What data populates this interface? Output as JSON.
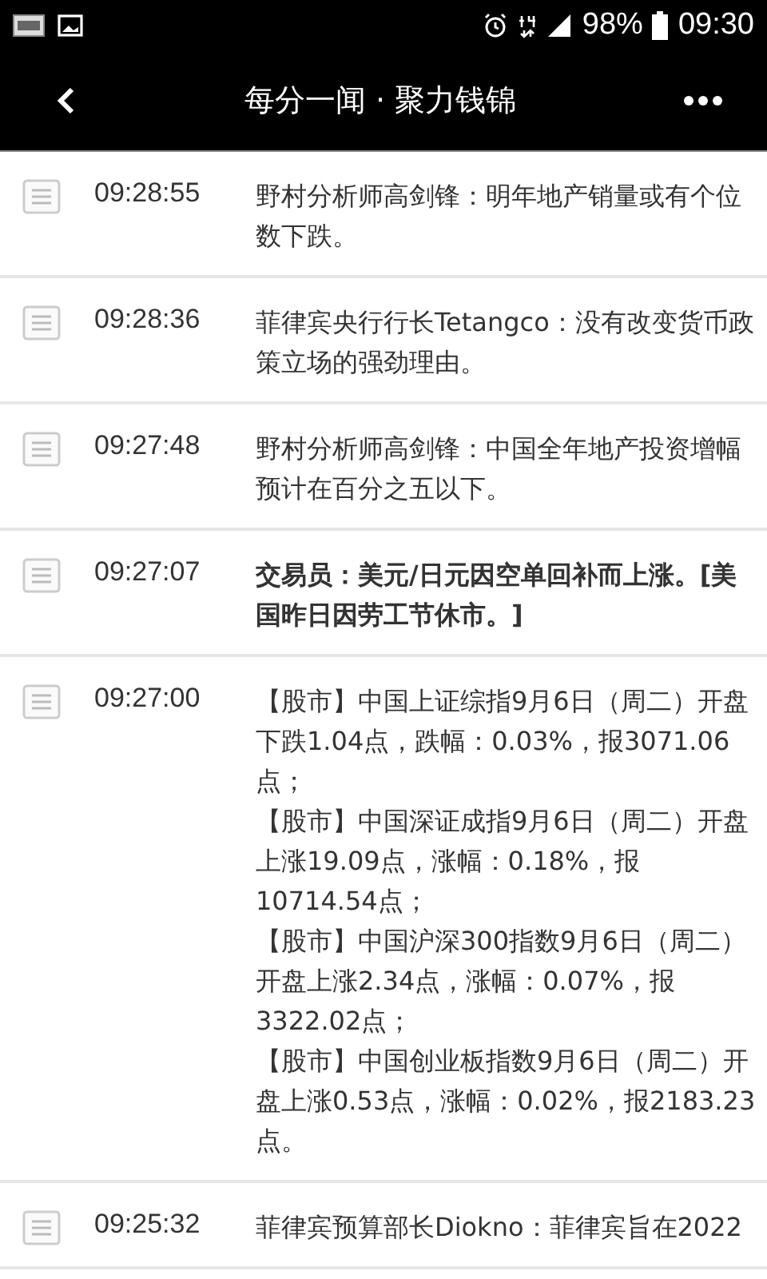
{
  "status_bar": {
    "battery": "98%",
    "time": "09:30"
  },
  "header": {
    "title": "每分一闻 · 聚力钱锦"
  },
  "news": [
    {
      "time": "09:28:55",
      "important": false,
      "paragraphs": [
        "野村分析师高剑锋：明年地产销量或有个位数下跌。"
      ]
    },
    {
      "time": "09:28:36",
      "important": false,
      "paragraphs": [
        "菲律宾央行行长Tetangco：没有改变货币政策立场的强劲理由。"
      ]
    },
    {
      "time": "09:27:48",
      "important": false,
      "paragraphs": [
        "野村分析师高剑锋：中国全年地产投资增幅预计在百分之五以下。"
      ]
    },
    {
      "time": "09:27:07",
      "important": true,
      "paragraphs": [
        "交易员：美元/日元因空单回补而上涨。[美国昨日因劳工节休市。]"
      ]
    },
    {
      "time": "09:27:00",
      "important": false,
      "paragraphs": [
        "【股市】中国上证综指9月6日（周二）开盘下跌1.04点，跌幅：0.03%，报3071.06点；",
        "【股市】中国深证成指9月6日（周二）开盘上涨19.09点，涨幅：0.18%，报10714.54点；",
        "【股市】中国沪深300指数9月6日（周二）开盘上涨2.34点，涨幅：0.07%，报3322.02点；",
        "【股市】中国创业板指数9月6日（周二）开盘上涨0.53点，涨幅：0.02%，报2183.23点。"
      ]
    },
    {
      "time": "09:25:32",
      "important": false,
      "paragraphs": [
        "菲律宾预算部长Diokno：菲律宾旨在2022"
      ]
    }
  ]
}
